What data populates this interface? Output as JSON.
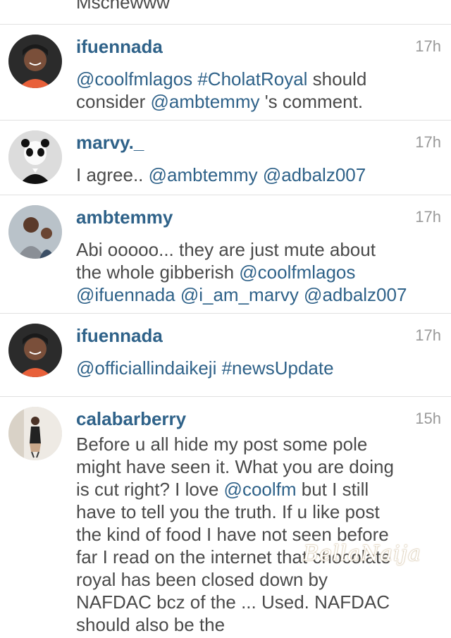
{
  "top_text": "Mschewww",
  "comments": [
    {
      "username": "ifuennada",
      "time": "17h",
      "lines": [
        [
          {
            "t": "@coolfmlagos #CholatRoyal",
            "m": true
          },
          {
            "t": " should",
            "m": false
          }
        ],
        [
          {
            "t": "consider ",
            "m": false
          },
          {
            "t": "@ambtemmy",
            "m": true
          },
          {
            "t": " 's comment.",
            "m": false
          }
        ]
      ]
    },
    {
      "username": "marvy._",
      "time": "17h",
      "lines": [
        [
          {
            "t": "I agree.. ",
            "m": false
          },
          {
            "t": "@ambtemmy @adbalz007",
            "m": true
          }
        ]
      ]
    },
    {
      "username": "ambtemmy",
      "time": "17h",
      "lines": [
        [
          {
            "t": "Abi ooooo... they are just mute about",
            "m": false
          }
        ],
        [
          {
            "t": "the whole gibberish ",
            "m": false
          },
          {
            "t": "@coolfmlagos",
            "m": true
          }
        ],
        [
          {
            "t": "@ifuennada @i_am_marvy @adbalz007",
            "m": true
          }
        ]
      ]
    },
    {
      "username": "ifuennada",
      "time": "17h",
      "lines": [
        [
          {
            "t": "@officiallindaikeji #newsUpdate",
            "m": true
          }
        ]
      ]
    },
    {
      "username": "calabarberry",
      "time": "15h",
      "lines": [
        [
          {
            "t": "Before u all hide my post some pole",
            "m": false
          }
        ],
        [
          {
            "t": "might have seen it. What you are doing",
            "m": false
          }
        ],
        [
          {
            "t": "is cut right? I love ",
            "m": false
          },
          {
            "t": "@coolfm",
            "m": true
          },
          {
            "t": " but I still",
            "m": false
          }
        ],
        [
          {
            "t": "have to tell you the truth. If u like post",
            "m": false
          }
        ],
        [
          {
            "t": "the kind of food I have not seen before",
            "m": false
          }
        ],
        [
          {
            "t": "far I read on the internet that chocolate",
            "m": false
          }
        ],
        [
          {
            "t": "royal has been closed down by",
            "m": false
          }
        ],
        [
          {
            "t": "NAFDAC bcz of the ... Used. NAFDAC",
            "m": false
          }
        ],
        [
          {
            "t": "should also be the",
            "m": false
          }
        ]
      ]
    }
  ],
  "watermark": "BellaNaija"
}
